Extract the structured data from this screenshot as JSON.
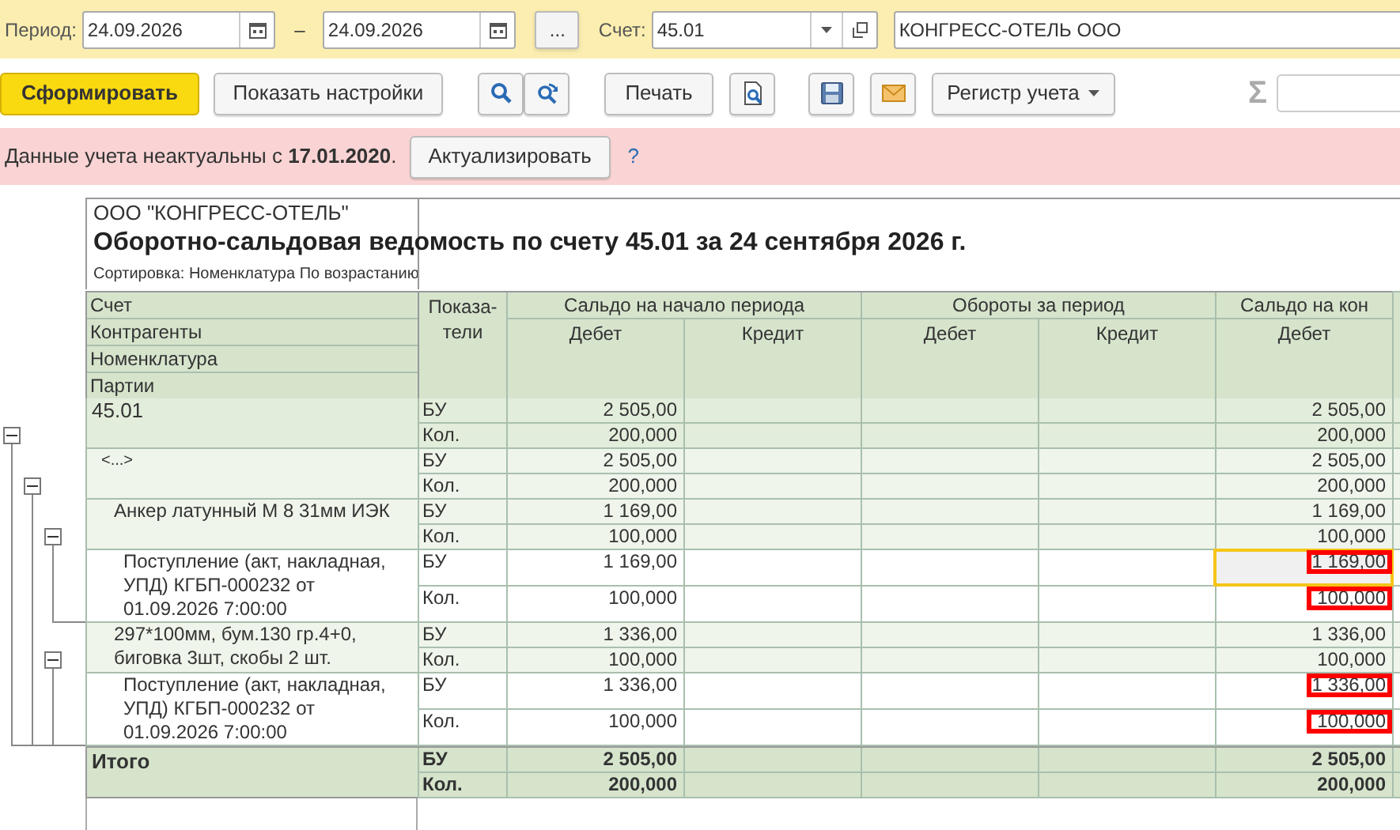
{
  "filters": {
    "period_label": "Период:",
    "date_from": "24.09.2026",
    "dash": "–",
    "date_to": "24.09.2026",
    "more_button": "...",
    "account_label": "Счет:",
    "account": "45.01",
    "counterparty": "КОНГРЕСС-ОТЕЛЬ ООО"
  },
  "toolbar": {
    "generate_button": "Сформировать",
    "settings_button": "Показать настройки",
    "print_button": "Печать",
    "register_button": "Регистр учета",
    "sum_sign": "Σ"
  },
  "banner": {
    "message": "Данные учета неактуальны с **17.01.2020**.",
    "refresh_button": "Актуализировать",
    "help": "?"
  },
  "report": {
    "organization": "ООО \"КОНГРЕСС-ОТЕЛЬ\"",
    "title": "Оборотно-сальдовая ведомость по счету 45.01 за 24 сентября 2026 г.",
    "sorting": "Сортировка: Номенклатура По возрастанию",
    "grouping_headers": [
      "Счет",
      "Контрагенты",
      "Номенклатура",
      "Партии"
    ],
    "indicators_header": "Показа-тели",
    "column_groups": [
      {
        "label": "Сальдо на начало периода",
        "columns": [
          "Дебет",
          "Кредит"
        ]
      },
      {
        "label": "Обороты за период",
        "columns": [
          "Дебет",
          "Кредит"
        ]
      },
      {
        "label": "Сальдо на кон",
        "columns": [
          "Дебет"
        ]
      }
    ],
    "tree": [
      {
        "name": "45.01",
        "expanded": true,
        "rows": [
          {
            "indicator": "БУ",
            "opening_debit": "2 505,00",
            "closing_debit": "2 505,00",
            "selected": false,
            "marked": false
          },
          {
            "indicator": "Кол.",
            "opening_debit": "200,000",
            "closing_debit": "200,000",
            "selected": false,
            "marked": false
          }
        ],
        "children": [
          {
            "name": "<...>",
            "expanded": true,
            "rows": [
              {
                "indicator": "БУ",
                "opening_debit": "2 505,00",
                "closing_debit": "2 505,00",
                "selected": false,
                "marked": false
              },
              {
                "indicator": "Кол.",
                "opening_debit": "200,000",
                "closing_debit": "200,000",
                "selected": false,
                "marked": false
              }
            ],
            "children": [
              {
                "name": "Анкер латунный М 8  31мм ИЭК",
                "expanded": true,
                "rows": [
                  {
                    "indicator": "БУ",
                    "opening_debit": "1 169,00",
                    "closing_debit": "1 169,00",
                    "selected": false,
                    "marked": false
                  },
                  {
                    "indicator": "Кол.",
                    "opening_debit": "100,000",
                    "closing_debit": "100,000",
                    "selected": false,
                    "marked": false
                  }
                ],
                "children": [
                  {
                    "name": "Поступление (акт, накладная, УПД) КГБП-000232 от 01.09.2026 7:00:00",
                    "rows": [
                      {
                        "indicator": "БУ",
                        "opening_debit": "1 169,00",
                        "closing_debit": "1 169,00",
                        "selected": true,
                        "marked": true
                      },
                      {
                        "indicator": "Кол.",
                        "opening_debit": "100,000",
                        "closing_debit": "100,000",
                        "selected": false,
                        "marked": true
                      }
                    ]
                  }
                ]
              },
              {
                "name": "297*100мм, бум.130 гр.4+0, биговка 3шт, скобы 2 шт.",
                "expanded": true,
                "rows": [
                  {
                    "indicator": "БУ",
                    "opening_debit": "1 336,00",
                    "closing_debit": "1 336,00",
                    "selected": false,
                    "marked": false
                  },
                  {
                    "indicator": "Кол.",
                    "opening_debit": "100,000",
                    "closing_debit": "100,000",
                    "selected": false,
                    "marked": false
                  }
                ],
                "children": [
                  {
                    "name": "Поступление (акт, накладная, УПД) КГБП-000232 от 01.09.2026 7:00:00",
                    "rows": [
                      {
                        "indicator": "БУ",
                        "opening_debit": "1 336,00",
                        "closing_debit": "1 336,00",
                        "selected": false,
                        "marked": true
                      },
                      {
                        "indicator": "Кол.",
                        "opening_debit": "100,000",
                        "closing_debit": "100,000",
                        "selected": false,
                        "marked": true
                      }
                    ]
                  }
                ]
              }
            ]
          }
        ]
      }
    ],
    "total": {
      "label": "Итого",
      "rows": [
        {
          "indicator": "БУ",
          "opening_debit": "2 505,00",
          "closing_debit": "2 505,00"
        },
        {
          "indicator": "Кол.",
          "opening_debit": "200,000",
          "closing_debit": "200,000"
        }
      ]
    }
  }
}
